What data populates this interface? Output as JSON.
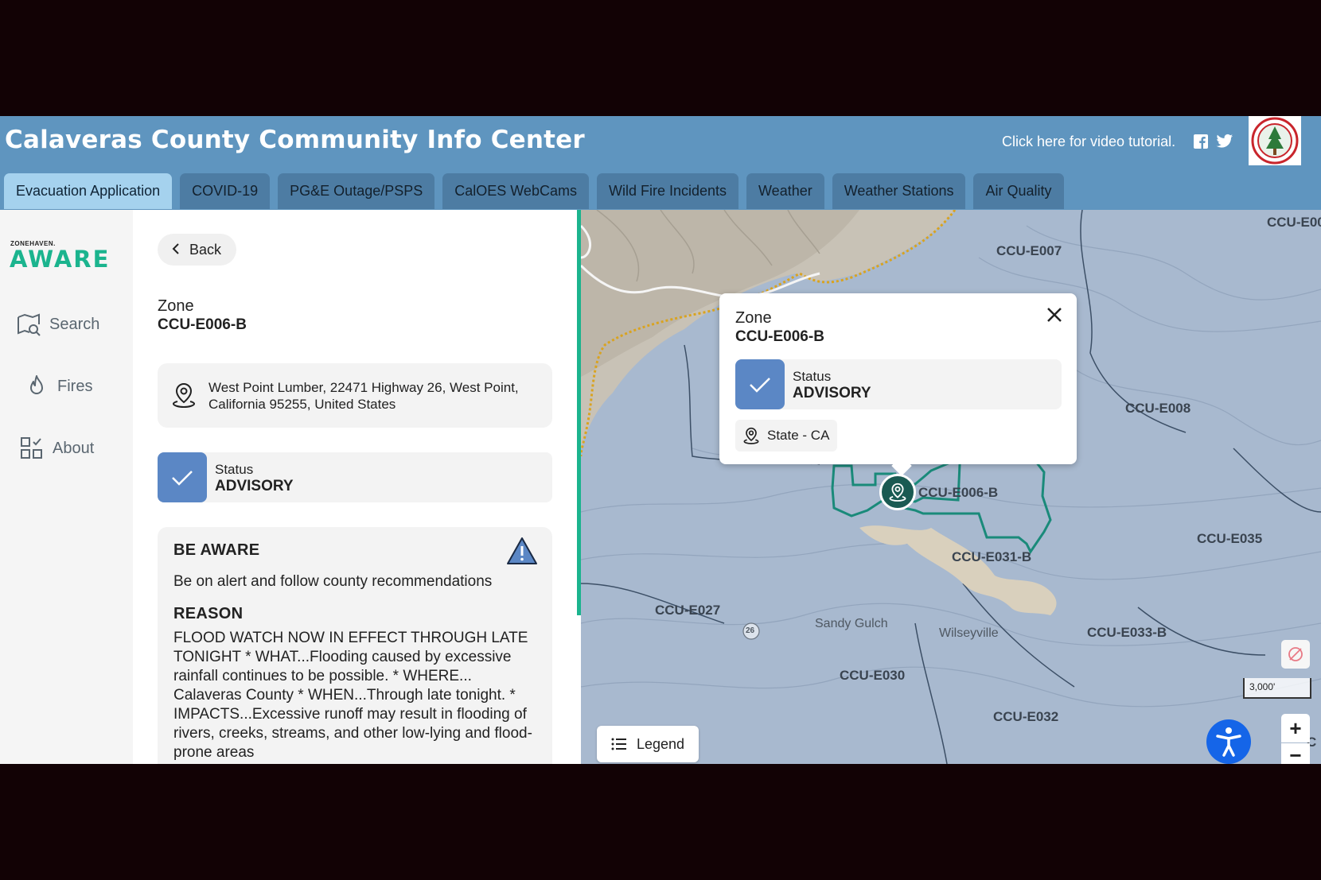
{
  "header": {
    "title": "Calaveras County Community Info Center",
    "tutorial_text": "Click here for video tutorial.",
    "social": [
      "facebook-icon",
      "twitter-icon"
    ],
    "seal_text": "CALAVERAS COUNTY"
  },
  "tabs": [
    {
      "label": "Evacuation Application",
      "active": true
    },
    {
      "label": "COVID-19"
    },
    {
      "label": "PG&E Outage/PSPS"
    },
    {
      "label": "CalOES WebCams"
    },
    {
      "label": "Wild Fire Incidents"
    },
    {
      "label": "Weather"
    },
    {
      "label": "Weather Stations"
    },
    {
      "label": "Air Quality"
    }
  ],
  "sidebar": {
    "logo_small": "ZONEHAVEN.",
    "logo_big": "AWARE",
    "items": [
      {
        "label": "Search",
        "icon": "map-search-icon"
      },
      {
        "label": "Fires",
        "icon": "flame-icon"
      },
      {
        "label": "About",
        "icon": "grid-check-icon"
      }
    ]
  },
  "panel": {
    "back_label": "Back",
    "zone_label": "Zone",
    "zone_name": "CCU-E006-B",
    "address": "West Point Lumber, 22471 Highway 26, West Point, California 95255, United States",
    "status_label": "Status",
    "status_value": "ADVISORY",
    "be_aware_title": "BE AWARE",
    "be_aware_text": "Be on alert and follow county recommendations",
    "reason_title": "REASON",
    "reason_text": "FLOOD WATCH NOW IN EFFECT THROUGH LATE TONIGHT * WHAT...Flooding caused by excessive rainfall continues to be possible. * WHERE... Calaveras County * WHEN...Through late tonight. * IMPACTS...Excessive runoff may result in flooding of rivers, creeks, streams, and other low-lying and flood-prone areas"
  },
  "map": {
    "zones": {
      "e00x": "CCU-E00",
      "e007": "CCU-E007",
      "e008": "CCU-E008",
      "e006b": "CCU-E006-B",
      "e035": "CCU-E035",
      "e031b": "CCU-E031-B",
      "e027": "CCU-E027",
      "e033b": "CCU-E033-B",
      "e030": "CCU-E030",
      "e032": "CCU-E032",
      "ec": "C"
    },
    "places": {
      "sandy_gulch": "Sandy Gulch",
      "wilseyville": "Wilseyville",
      "hwy": "26"
    },
    "popup": {
      "zone_label": "Zone",
      "zone_name": "CCU-E006-B",
      "status_label": "Status",
      "status_value": "ADVISORY",
      "state_label": "State - CA"
    },
    "legend_label": "Legend",
    "scale_label": "3,000'",
    "zoom_in": "+",
    "zoom_out": "−"
  },
  "colors": {
    "header_bg": "#5f95bf",
    "tab_active": "#a5d2ee",
    "tab_bg": "#4d7ca3",
    "accent_green": "#1bb48e",
    "status_blue": "#5b87c5",
    "zone_outline": "#1a8a7a"
  }
}
